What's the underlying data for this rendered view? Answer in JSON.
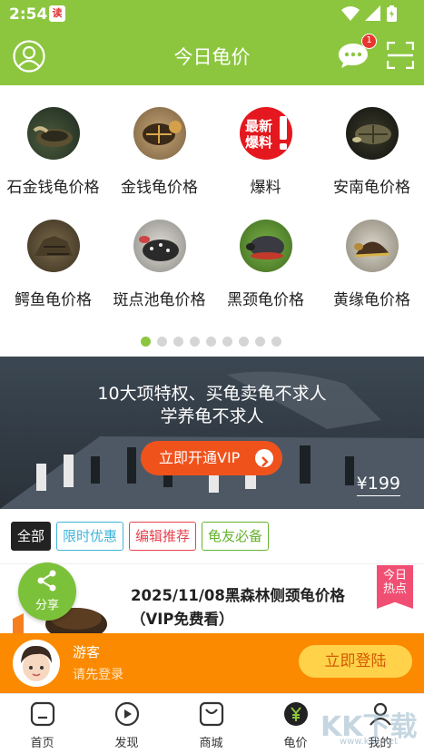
{
  "status_bar": {
    "time": "2:54",
    "app_badge": "读"
  },
  "header": {
    "title": "今日龟价",
    "message_count": "1"
  },
  "categories": [
    {
      "label": "石金钱龟价格",
      "icon": "turtle-photo"
    },
    {
      "label": "金钱龟价格",
      "icon": "turtle-photo"
    },
    {
      "label": "爆料",
      "icon": "breaking-news-icon",
      "icon_text": "最新爆料"
    },
    {
      "label": "安南龟价格",
      "icon": "turtle-photo"
    },
    {
      "label": "鳄鱼龟价格",
      "icon": "turtle-photo"
    },
    {
      "label": "斑点池龟价格",
      "icon": "turtle-photo"
    },
    {
      "label": "黑颈龟价格",
      "icon": "turtle-photo"
    },
    {
      "label": "黄缘龟价格",
      "icon": "turtle-photo"
    }
  ],
  "pager": {
    "count": 9,
    "active": 0
  },
  "banner": {
    "line1": "10大项特权、买龟卖龟不求人",
    "line2": "学养龟不求人",
    "button": "立即开通VIP",
    "price": "¥199"
  },
  "filter_tags": [
    "全部",
    "限时优惠",
    "编辑推荐",
    "龟友必备"
  ],
  "article": {
    "title": "2025/11/08黑森林侧颈龟价格（VIP免费看）",
    "badge_line1": "今日",
    "badge_line2": "热点"
  },
  "share": {
    "label": "分享"
  },
  "login_bar": {
    "guest": "游客",
    "prompt": "请先登录",
    "button": "立即登陆"
  },
  "bottom_nav": [
    {
      "label": "首页",
      "icon": "home-icon"
    },
    {
      "label": "发现",
      "icon": "play-icon"
    },
    {
      "label": "商城",
      "icon": "shop-bag-icon"
    },
    {
      "label": "龟价",
      "icon": "yuan-icon",
      "active": true
    },
    {
      "label": "我的",
      "icon": "profile-icon"
    }
  ],
  "watermark": {
    "text": "KK下载",
    "url": "www.kkx.net"
  },
  "colors": {
    "brand": "#8cc63f",
    "login_bar": "#fb8a00",
    "vip_button": "#f0521c"
  }
}
